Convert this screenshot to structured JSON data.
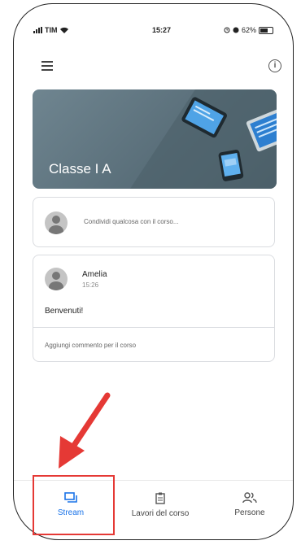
{
  "status_bar": {
    "carrier": "TIM",
    "time": "15:27",
    "battery": "62%"
  },
  "header": {
    "menu_icon": "hamburger-menu-icon",
    "info_icon": "info-icon",
    "info_glyph": "i"
  },
  "class": {
    "title": "Classe I A"
  },
  "share": {
    "placeholder": "Condividi qualcosa con il corso..."
  },
  "post": {
    "author": "Amelia",
    "time": "15:26",
    "body": "Benvenuti!",
    "comment_placeholder": "Aggiungi commento per il corso"
  },
  "bottom_nav": {
    "items": [
      {
        "label": "Stream",
        "icon": "stream-icon",
        "active": true
      },
      {
        "label": "Lavori del corso",
        "icon": "classwork-icon",
        "active": false
      },
      {
        "label": "Persone",
        "icon": "people-icon",
        "active": false
      }
    ]
  },
  "colors": {
    "accent": "#1a73e8",
    "highlight": "#e53935",
    "banner": "#5e737e"
  }
}
